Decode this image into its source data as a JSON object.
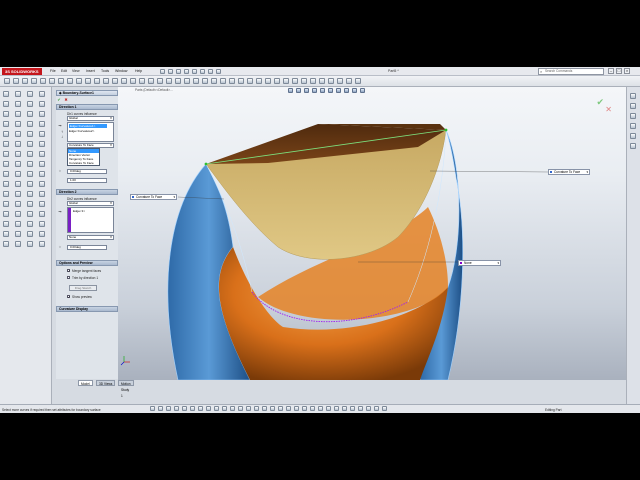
{
  "app": {
    "logo": "3S SOLIDWORKS",
    "doc_title": "Part5 *"
  },
  "menu": [
    "File",
    "Edit",
    "View",
    "Insert",
    "Tools",
    "Window",
    "Help"
  ],
  "search": {
    "placeholder": "Search Commands"
  },
  "property_manager": {
    "title": "Boundary-Surface1",
    "direction1": {
      "header": "Direction 1",
      "influence_label": "Dir1 curves influence",
      "influence_value": "Global",
      "curves": [
        "Edge<Curvature1>",
        "Edge<Curvature2>"
      ],
      "condition_selected": "Curvature To Face",
      "condition_options": [
        "None",
        "Direction Vector",
        "Tangency To Face",
        "Curvature To Face"
      ],
      "angle": "0.00deg",
      "weight": "1.00"
    },
    "direction2": {
      "header": "Direction 2",
      "influence_label": "Dir2 curves influence",
      "influence_value": "Global",
      "curves": [
        "Edge<1>"
      ],
      "condition_selected": "None",
      "angle": "0.00deg"
    },
    "options": {
      "header": "Options and Preview",
      "merge": "Merge tangent faces",
      "trim": "Trim by direction 1",
      "drag": "Drag Sketch",
      "show_preview": "Show preview"
    },
    "curvature_display": {
      "header": "Curvature Display"
    }
  },
  "viewport": {
    "fm_tab": "Parts (Default<<Default>...",
    "callouts": [
      {
        "label": "Curvature To Face",
        "color": "#3366cc"
      },
      {
        "label": "Curvature To Face",
        "color": "#3366cc"
      },
      {
        "label": "None",
        "color": "#8800cc"
      }
    ]
  },
  "bottom_tabs": [
    "Model",
    "3D Views",
    "Motion Study 1"
  ],
  "status": {
    "message": "Select more curves if required then set attributes for boundary surface",
    "mode": "Editing Part"
  },
  "colors": {
    "body_blue": "#3f7fc0",
    "body_orange": "#e17b1d",
    "preview_yellow": "#d2b870",
    "top_brown": "#6b3a12"
  }
}
